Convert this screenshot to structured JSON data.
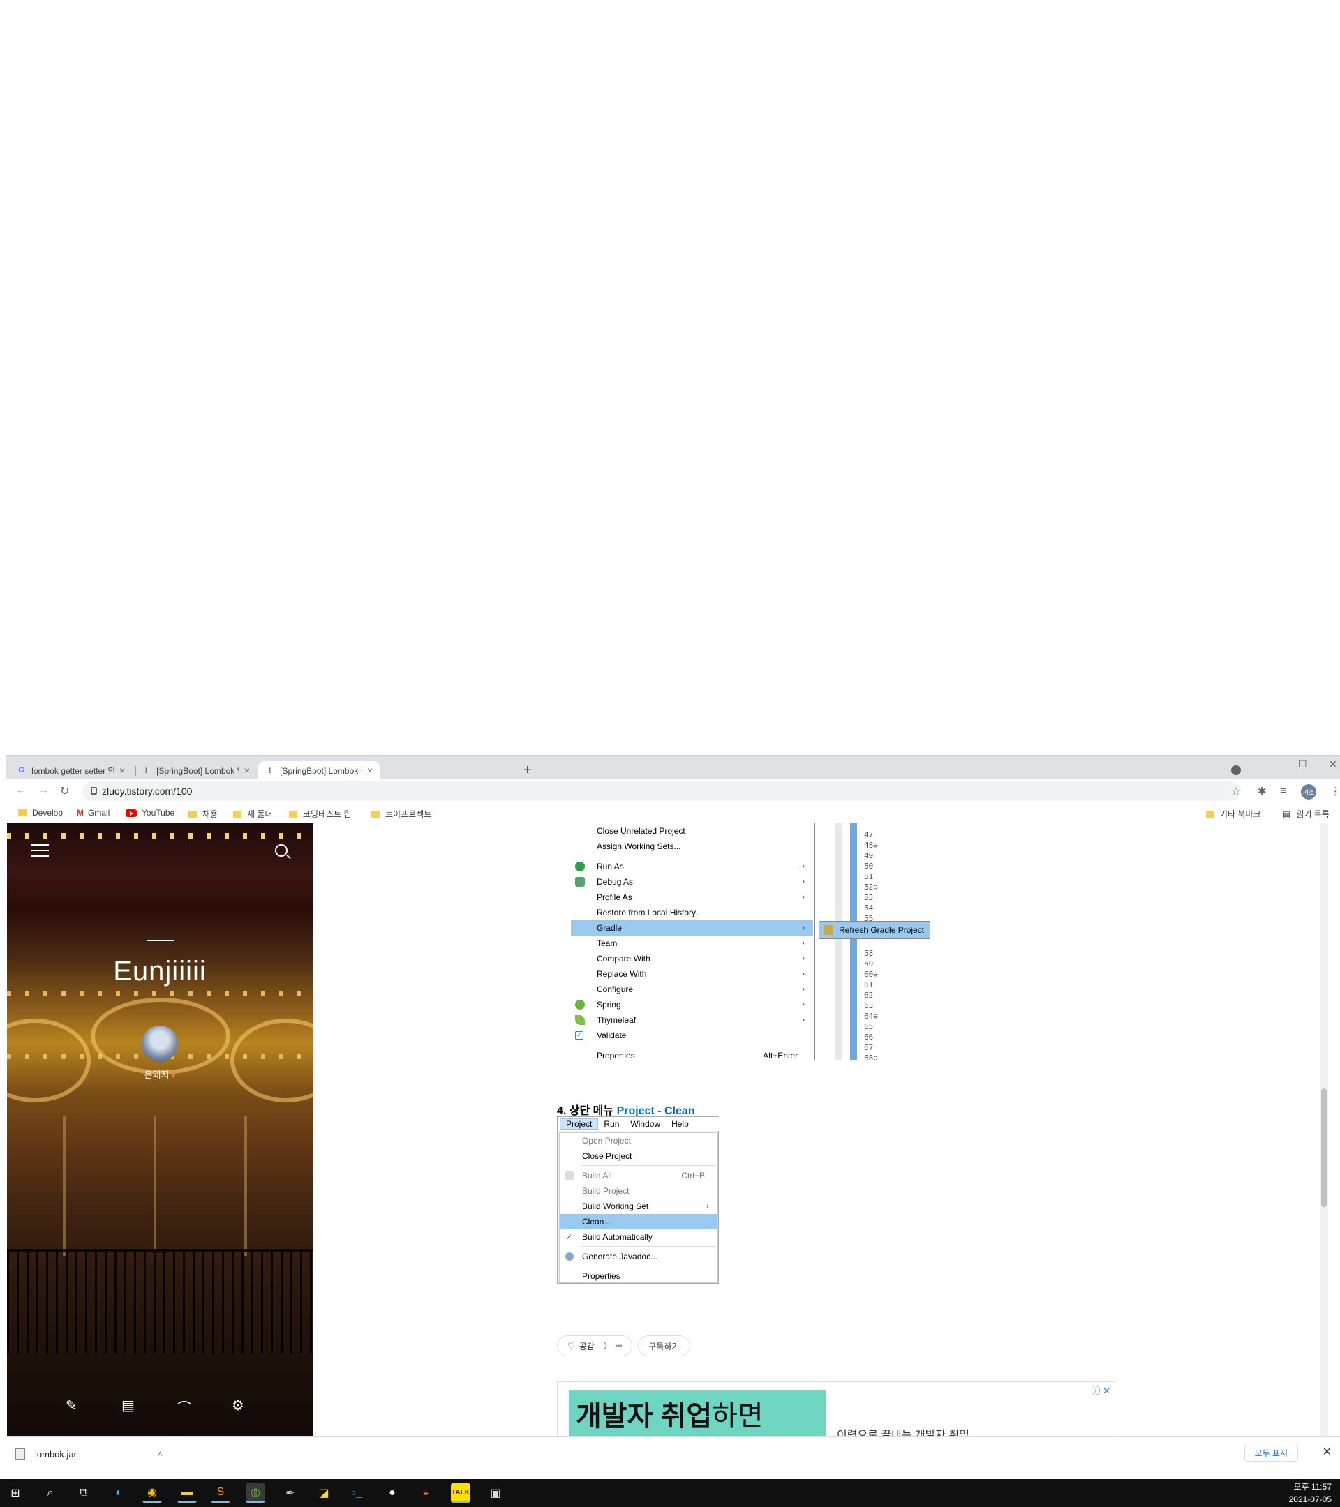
{
  "browser": {
    "tabs": [
      {
        "title": "lombok getter setter 안됨 - Goo",
        "favicon": "google-g-icon"
      },
      {
        "title": "[SpringBoot] Lombok 인식 안됨",
        "favicon": "tistory-icon"
      },
      {
        "title": "[SpringBoot] Lombok 적용 안됨",
        "favicon": "tistory-icon",
        "active": true
      }
    ],
    "new_tab": "+",
    "url": "zluoy.tistory.com/100",
    "profile_initials": "기호",
    "bookmarks_left": [
      {
        "label": "Develop",
        "icon": "folder-icon"
      },
      {
        "label": "Gmail",
        "icon": "gmail-icon"
      },
      {
        "label": "YouTube",
        "icon": "youtube-icon"
      },
      {
        "label": "채용",
        "icon": "folder-icon"
      },
      {
        "label": "새 폴더",
        "icon": "folder-icon"
      },
      {
        "label": "코딩테스트 팁",
        "icon": "folder-icon"
      },
      {
        "label": "토이프로젝트",
        "icon": "folder-icon"
      }
    ],
    "bookmarks_right": [
      {
        "label": "기타 북마크",
        "icon": "folder-icon"
      },
      {
        "label": "읽기 목록",
        "icon": "reading-list-icon"
      }
    ]
  },
  "blog": {
    "title": "Eunjiiiii",
    "owner": "은돼지",
    "owner_badge": "♥"
  },
  "post": {
    "context_menu": [
      {
        "label": "Close Unrelated Project",
        "arrow": false
      },
      {
        "label": "Assign Working Sets...",
        "arrow": false
      },
      {
        "label": "Run As",
        "arrow": true,
        "icon": "run-icon"
      },
      {
        "label": "Debug As",
        "arrow": true,
        "icon": "debug-icon"
      },
      {
        "label": "Profile As",
        "arrow": true
      },
      {
        "label": "Restore from Local History...",
        "arrow": false
      },
      {
        "label": "Gradle",
        "arrow": true,
        "selected": true
      },
      {
        "label": "Team",
        "arrow": true
      },
      {
        "label": "Compare With",
        "arrow": true
      },
      {
        "label": "Replace With",
        "arrow": true
      },
      {
        "label": "Configure",
        "arrow": true
      },
      {
        "label": "Spring",
        "arrow": true,
        "icon": "spring-icon"
      },
      {
        "label": "Thymeleaf",
        "arrow": true,
        "icon": "thymeleaf-icon"
      },
      {
        "label": "Validate",
        "arrow": false,
        "icon": "checkbox-icon"
      },
      {
        "label": "Properties",
        "shortcut": "Alt+Enter"
      }
    ],
    "submenu_item": "Refresh Gradle Project",
    "line_numbers": [
      "47",
      "48⊖",
      "49",
      "50",
      "51",
      "52⊖",
      "53",
      "54",
      "55",
      "58",
      "59",
      "60⊖",
      "61",
      "62",
      "63",
      "64⊖",
      "65",
      "66",
      "67",
      "68⊖"
    ],
    "step4_prefix": "4. 상단 메뉴 ",
    "step4_highlight": "Project - Clean",
    "project_menubar": [
      "Project",
      "Run",
      "Window",
      "Help"
    ],
    "project_menu": [
      {
        "label": "Open Project",
        "disabled": true
      },
      {
        "label": "Close Project"
      },
      {
        "label": "Build All",
        "shortcut": "Ctrl+B",
        "disabled": true
      },
      {
        "label": "Build Project",
        "disabled": true
      },
      {
        "label": "Build Working Set",
        "arrow": true
      },
      {
        "label": "Clean...",
        "selected": true
      },
      {
        "label": "Build Automatically",
        "checked": true
      },
      {
        "label": "Generate Javadoc..."
      },
      {
        "label": "Properties"
      }
    ],
    "like_label": "공감",
    "more_label": "•••",
    "subscribe_label": "구독하기",
    "ad_headline_bold": "개발자 취업",
    "ad_headline_light": "하면",
    "ad_text": "이력으로 끝내는 개발자 취업"
  },
  "downloads": {
    "file": "lombok.jar",
    "show_all": "모두 표시"
  },
  "taskbar": {
    "time": "오후 11:57",
    "date": "2021-07-05"
  }
}
